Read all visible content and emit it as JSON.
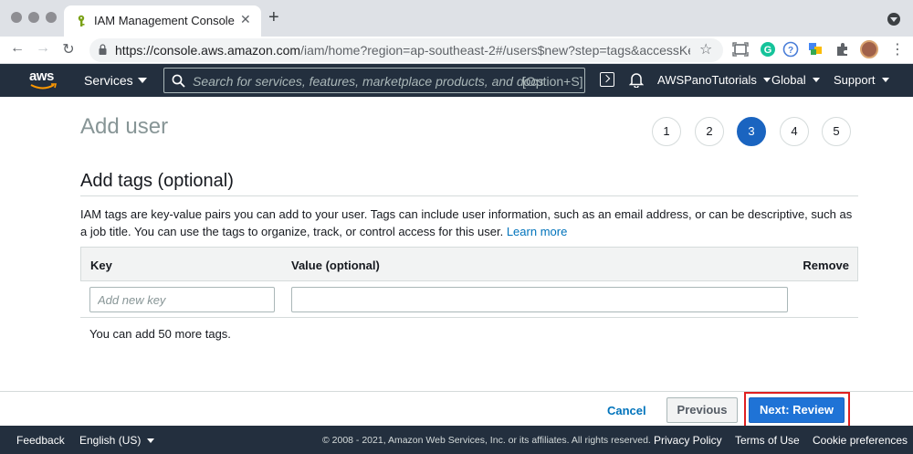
{
  "browser": {
    "tab_title": "IAM Management Console",
    "url_host": "https://console.aws.amazon.com",
    "url_path": "/iam/home?region=ap-southeast-2#/users$new?step=tags&accessKey&..."
  },
  "aws_nav": {
    "logo_text": "aws",
    "services_label": "Services",
    "search_placeholder": "Search for services, features, marketplace products, and docs",
    "search_shortcut": "[Option+S]",
    "account_label": "AWSPanoTutorials",
    "region_label": "Global",
    "support_label": "Support"
  },
  "page": {
    "title": "Add user",
    "steps": [
      "1",
      "2",
      "3",
      "4",
      "5"
    ],
    "active_step": "3"
  },
  "section": {
    "title": "Add tags (optional)",
    "description": "IAM tags are key-value pairs you can add to your user. Tags can include user information, such as an email address, or can be descriptive, such as a job title. You can use the tags to organize, track, or control access for this user.",
    "learn_more": "Learn more"
  },
  "tags_table": {
    "headers": {
      "key": "Key",
      "value": "Value (optional)",
      "remove": "Remove"
    },
    "key_placeholder": "Add new key",
    "key_value": "",
    "value_value": "",
    "remaining_text": "You can add 50 more tags."
  },
  "actions": {
    "cancel": "Cancel",
    "previous": "Previous",
    "next": "Next: Review"
  },
  "console_footer": {
    "feedback": "Feedback",
    "language": "English (US)",
    "copyright": "© 2008 - 2021, Amazon Web Services, Inc. or its affiliates. All rights reserved.",
    "privacy": "Privacy Policy",
    "terms": "Terms of Use",
    "cookies": "Cookie preferences"
  },
  "colors": {
    "aws_nav_bg": "#232f3e",
    "primary_blue": "#1f73d6",
    "link_blue": "#0073bb",
    "highlight_red": "#e02020"
  }
}
